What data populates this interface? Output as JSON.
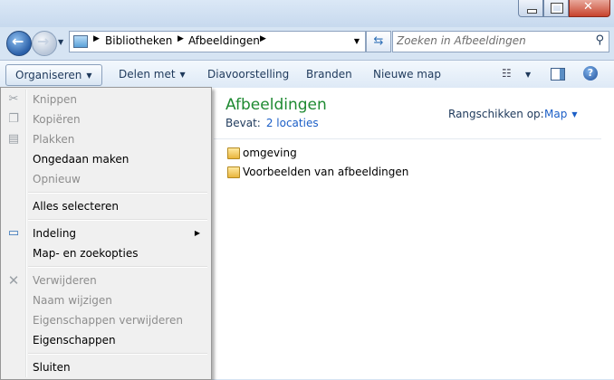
{
  "nav": {
    "breadcrumb": [
      "Bibliotheken",
      "Afbeeldingen"
    ],
    "search_placeholder": "Zoeken in Afbeeldingen"
  },
  "toolbar": {
    "organize": "Organiseren",
    "share": "Delen met",
    "slideshow": "Diavoorstelling",
    "burn": "Branden",
    "new_folder": "Nieuwe map"
  },
  "library": {
    "title": "Afbeeldingen",
    "contains_label": "Bevat:",
    "locations_link": "2 locaties",
    "arrange_label": "Rangschikken op:",
    "arrange_value": "Map",
    "folders": [
      "omgeving",
      "Voorbeelden van afbeeldingen"
    ]
  },
  "menu": {
    "cut": "Knippen",
    "copy": "Kopiëren",
    "paste": "Plakken",
    "undo": "Ongedaan maken",
    "redo": "Opnieuw",
    "select_all": "Alles selecteren",
    "layout": "Indeling",
    "folder_options": "Map- en zoekopties",
    "delete": "Verwijderen",
    "rename": "Naam wijzigen",
    "remove_properties": "Eigenschappen verwijderen",
    "properties": "Eigenschappen",
    "close": "Sluiten"
  },
  "colors": {
    "library_title": "#1e8a31",
    "link": "#1c5fc7",
    "disabled_text": "#8d8d8d"
  }
}
